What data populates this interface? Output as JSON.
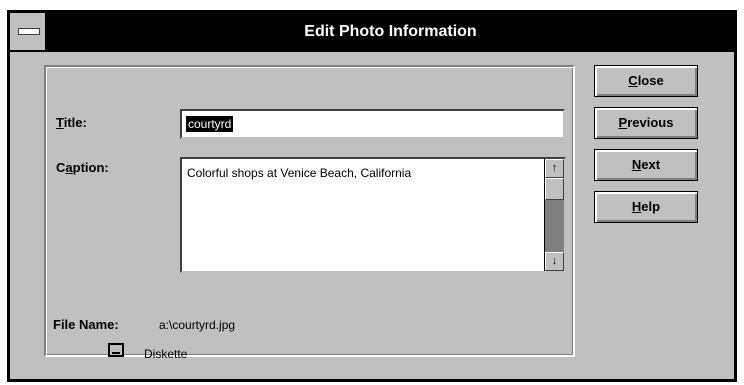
{
  "window": {
    "title": "Edit Photo Information"
  },
  "form": {
    "title_label": "Title:",
    "title_value": "courtyrd",
    "caption_label": "Caption:",
    "caption_value": "Colorful shops at Venice Beach, California",
    "file_name_label": "File Name:",
    "file_name_value": "a:\\courtyrd.jpg",
    "media_label": "Diskette",
    "media_icon": "diskette-icon"
  },
  "buttons": {
    "close": "Close",
    "previous": "Previous",
    "next": "Next",
    "help": "Help"
  },
  "scrollbar": {
    "up_glyph": "↑",
    "down_glyph": "↓"
  }
}
